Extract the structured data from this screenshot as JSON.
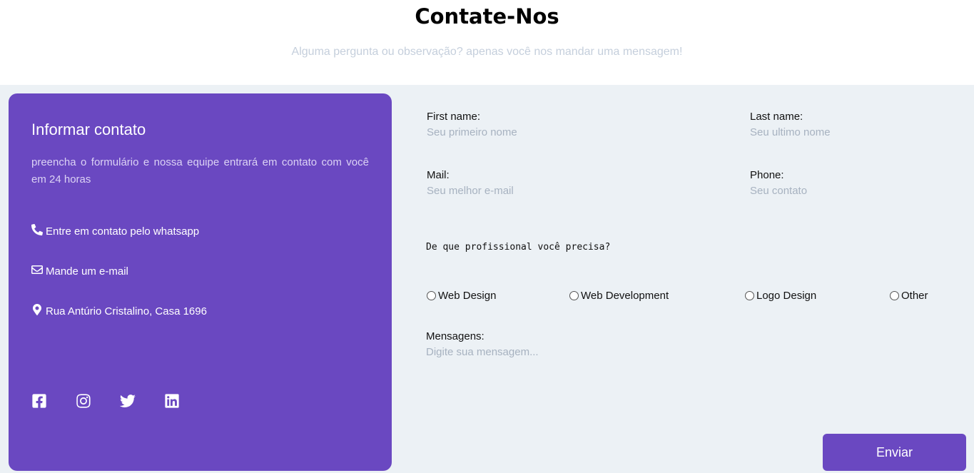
{
  "header": {
    "title": "Contate-Nos",
    "subtitle": "Alguma pergunta ou observação? apenas você nos mandar uma mensagem!"
  },
  "info": {
    "title": "Informar contato",
    "description": "preencha o formulário e nossa equipe entrará em contato com você em 24 horas",
    "whatsapp": "Entre em contato pelo whatsapp",
    "email": "Mande um e-mail",
    "address": "Rua Antúrio Cristalino, Casa 1696",
    "socials": [
      "facebook-icon",
      "instagram-icon",
      "twitter-icon",
      "linkedin-icon"
    ],
    "icons": {
      "whatsapp": "phone-icon",
      "email": "envelope-icon",
      "address": "map-marker-icon"
    }
  },
  "form": {
    "first_name": {
      "label": "First name:",
      "placeholder": "Seu primeiro nome",
      "value": ""
    },
    "last_name": {
      "label": "Last name:",
      "placeholder": "Seu ultimo nome",
      "value": ""
    },
    "mail": {
      "label": "Mail:",
      "placeholder": "Seu melhor e-mail",
      "value": ""
    },
    "phone": {
      "label": "Phone:",
      "placeholder": "Seu contato",
      "value": ""
    },
    "question": "De que profissional você precisa?",
    "options": [
      {
        "label": "Web Design",
        "checked": false
      },
      {
        "label": "Web Development",
        "checked": false
      },
      {
        "label": "Logo Design",
        "checked": false
      },
      {
        "label": "Other",
        "checked": false
      }
    ],
    "message": {
      "label": "Mensagens:",
      "placeholder": "Digite sua mensagem...",
      "value": ""
    },
    "submit_label": "Enviar"
  },
  "colors": {
    "accent": "#6a48c1",
    "background": "#ecf1f5",
    "placeholder": "#a7b2c0",
    "subtitle": "#c5cfdc"
  }
}
